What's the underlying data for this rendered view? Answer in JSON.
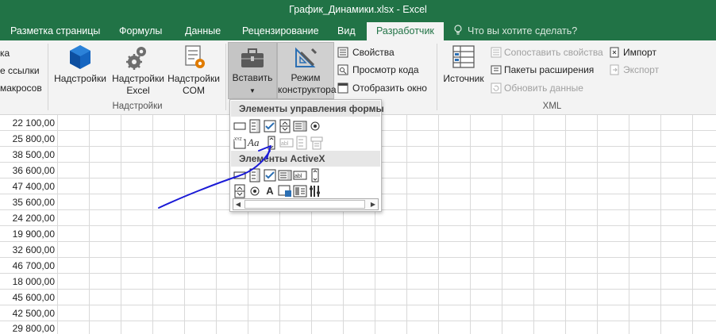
{
  "window": {
    "title": "График_Динамики.xlsx - Excel"
  },
  "tabs": [
    {
      "label": "Разметка страницы",
      "active": false
    },
    {
      "label": "Формулы",
      "active": false
    },
    {
      "label": "Данные",
      "active": false
    },
    {
      "label": "Рецензирование",
      "active": false
    },
    {
      "label": "Вид",
      "active": false
    },
    {
      "label": "Разработчик",
      "active": true
    }
  ],
  "tell_me": {
    "label": "Что вы хотите сделать?"
  },
  "ribbon": {
    "code_partial": [
      "ка",
      "е ссылки",
      "макросов"
    ],
    "addins": {
      "addins_button": "Надстройки",
      "excel_addins_line1": "Надстройки",
      "excel_addins_line2": "Excel",
      "com_addins_line1": "Надстройки",
      "com_addins_line2": "COM",
      "group_label": "Надстройки"
    },
    "controls": {
      "insert_button": "Вставить",
      "design_mode_line1": "Режим",
      "design_mode_line2": "конструктора",
      "properties": "Свойства",
      "view_code": "Просмотр кода",
      "run_dialog": "Отобразить окно"
    },
    "xml": {
      "source_button": "Источник",
      "map_properties": "Сопоставить свойства",
      "expansion_packs": "Пакеты расширения",
      "refresh_data": "Обновить данные",
      "import": "Импорт",
      "export": "Экспорт",
      "group_label": "XML"
    }
  },
  "dropdown": {
    "form_controls_header": "Элементы управления формы",
    "activex_header": "Элементы ActiveX",
    "label_glyph": "Aa",
    "textbox_glyph": "abl",
    "frame_glyph": "XYZ",
    "activex_label_glyph": "A"
  },
  "cells": [
    "22 100,00",
    "25 800,00",
    "38 500,00",
    "36 600,00",
    "47 400,00",
    "35 600,00",
    "24 200,00",
    "19 900,00",
    "32 600,00",
    "46 700,00",
    "18 000,00",
    "45 600,00",
    "42 500,00",
    "29 800,00"
  ],
  "colors": {
    "excel_green": "#217346",
    "ribbon_bg": "#f3f3f3",
    "annotation_ink": "#1a1ad6"
  }
}
